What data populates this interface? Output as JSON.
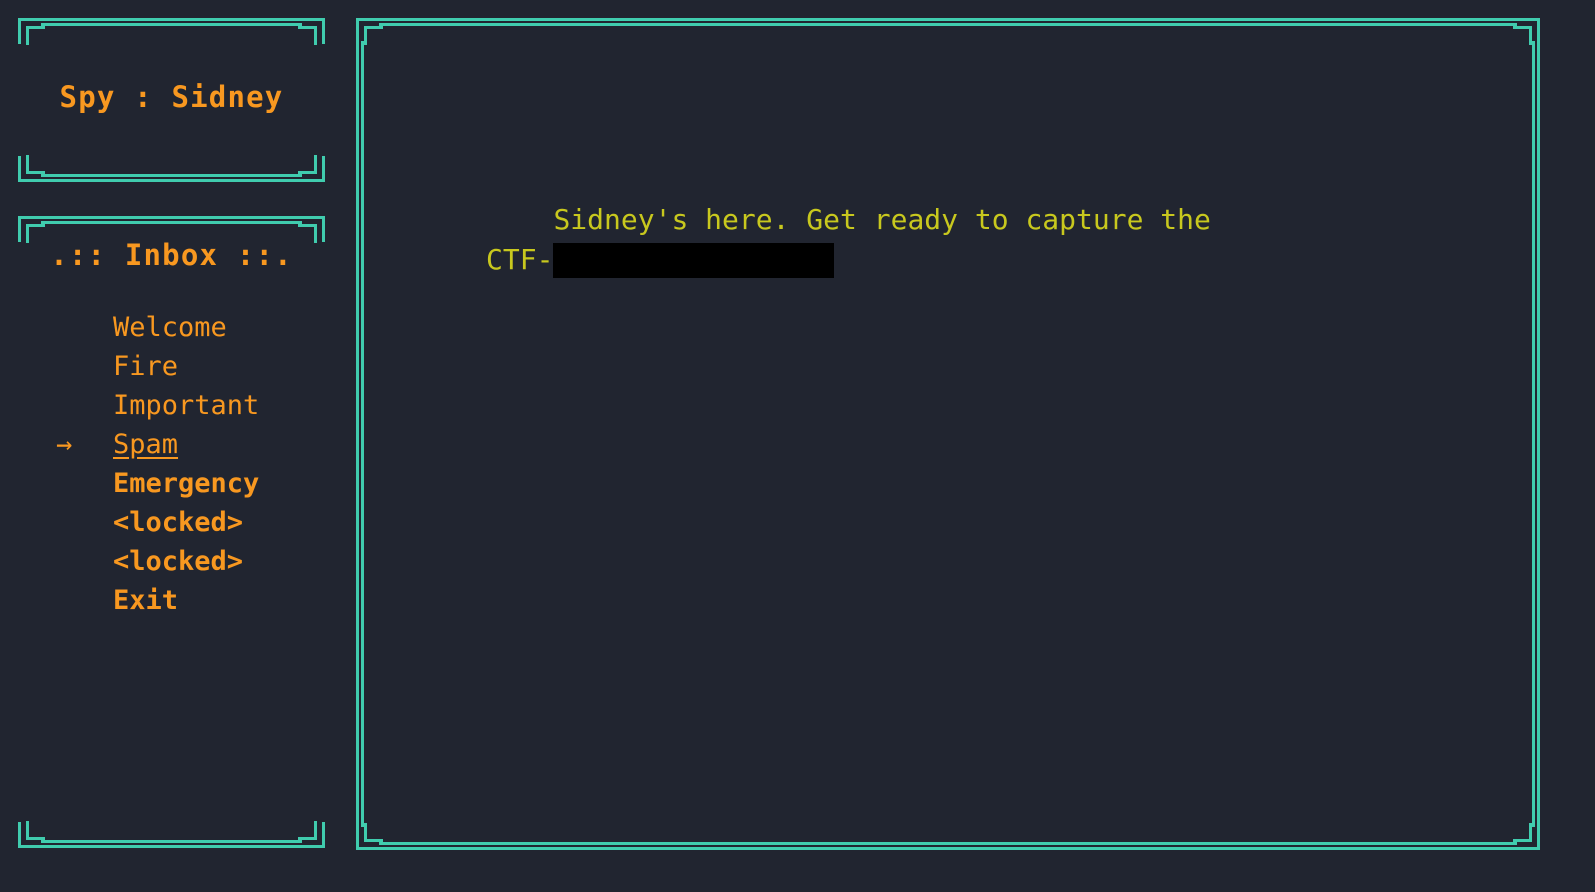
{
  "theme": {
    "background": "#212530",
    "border": "#40ccae",
    "accent": "#f89820",
    "body_text": "#c8c81e",
    "redaction": "#000000"
  },
  "title_panel": {
    "title": "Spy : Sidney"
  },
  "inbox_panel": {
    "header": ".:: Inbox ::.",
    "selected_index": 3,
    "items": [
      {
        "label": "Welcome",
        "marker": "",
        "bold": false,
        "selected": false
      },
      {
        "label": "Fire",
        "marker": "",
        "bold": false,
        "selected": false
      },
      {
        "label": "Important",
        "marker": "",
        "bold": false,
        "selected": false
      },
      {
        "label": "Spam",
        "marker": "→",
        "bold": false,
        "selected": true
      },
      {
        "label": "Emergency",
        "marker": "",
        "bold": true,
        "selected": false
      },
      {
        "label": "<locked>",
        "marker": "",
        "bold": true,
        "selected": false
      },
      {
        "label": "<locked>",
        "marker": "",
        "bold": true,
        "selected": false
      },
      {
        "label": "Exit",
        "marker": "",
        "bold": true,
        "selected": false
      }
    ]
  },
  "message_panel": {
    "body_before": "Sidney's here. Get ready to capture the CTF-",
    "redacted": true,
    "body_after": ""
  }
}
